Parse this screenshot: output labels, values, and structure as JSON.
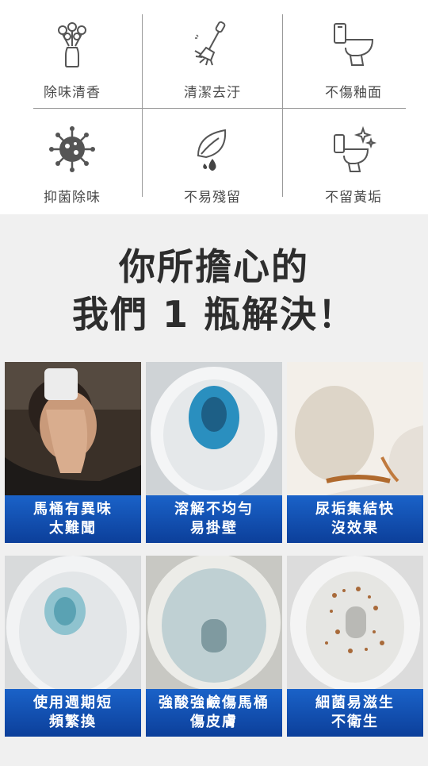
{
  "features": [
    {
      "label": "除味清香",
      "icon": "flower-vase-icon"
    },
    {
      "label": "清潔去汙",
      "icon": "toilet-brush-icon"
    },
    {
      "label": "不傷釉面",
      "icon": "toilet-icon"
    },
    {
      "label": "抑菌除味",
      "icon": "germ-icon"
    },
    {
      "label": "不易殘留",
      "icon": "leaf-drop-icon"
    },
    {
      "label": "不留黃垢",
      "icon": "sparkling-toilet-icon"
    }
  ],
  "headline": {
    "line1": "你所擔心的",
    "line2": "我們 1 瓶解決！"
  },
  "problems": [
    {
      "line1": "馬桶有異味",
      "line2": "太難聞"
    },
    {
      "line1": "溶解不均勻",
      "line2": "易掛壁"
    },
    {
      "line1": "尿垢集結快",
      "line2": "沒效果"
    },
    {
      "line1": "使用週期短",
      "line2": "頻繁換"
    },
    {
      "line1": "強酸強鹼傷馬桶",
      "line2": "傷皮膚"
    },
    {
      "line1": "細菌易滋生",
      "line2": "不衛生"
    }
  ],
  "colors": {
    "caption_bg": "#1a62c8",
    "headline": "#2d2d2d",
    "icon": "#555555"
  }
}
